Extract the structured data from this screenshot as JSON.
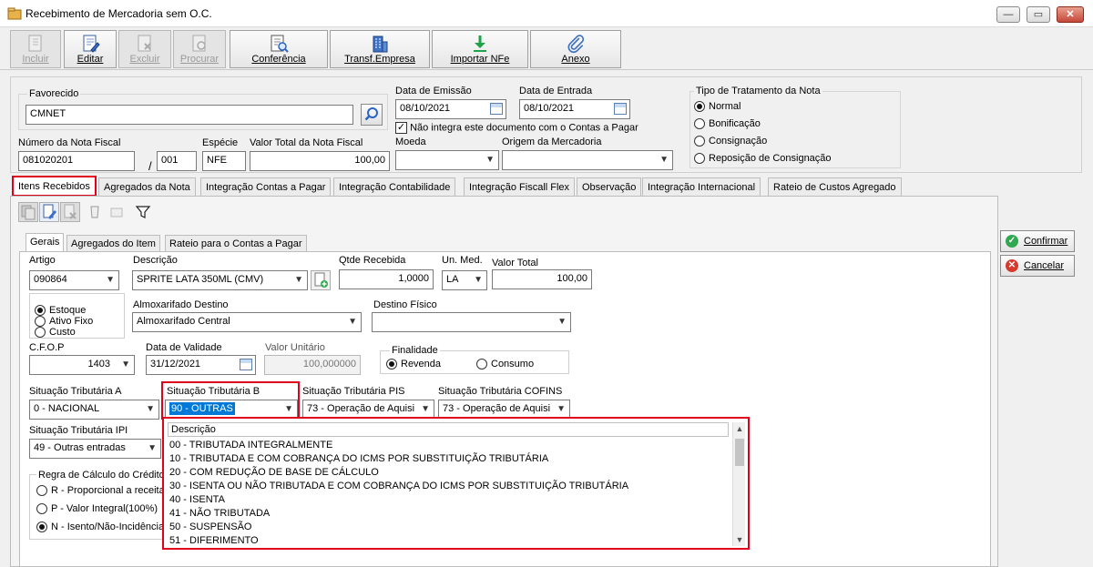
{
  "window": {
    "title": "Recebimento de Mercadoria sem O.C."
  },
  "toolbar": {
    "buttons": [
      {
        "label": "Incluir",
        "icon": "new-document-icon",
        "enabled": false
      },
      {
        "label": "Editar",
        "icon": "edit-document-icon",
        "enabled": true
      },
      {
        "label": "Excluir",
        "icon": "delete-document-icon",
        "enabled": false
      },
      {
        "label": "Procurar",
        "icon": "search-document-icon",
        "enabled": false
      },
      {
        "label": "Conferência",
        "icon": "conference-icon",
        "enabled": true
      },
      {
        "label": "Transf.Empresa",
        "icon": "building-icon",
        "enabled": true
      },
      {
        "label": "Importar NFe",
        "icon": "download-arrow-icon",
        "enabled": true
      },
      {
        "label": "Anexo",
        "icon": "paperclip-icon",
        "enabled": true
      }
    ]
  },
  "header": {
    "favorecido_label": "Favorecido",
    "favorecido_value": "CMNET",
    "data_emissao_label": "Data de Emissão",
    "data_emissao_value": "08/10/2021",
    "data_entrada_label": "Data de Entrada",
    "data_entrada_value": "08/10/2021",
    "nao_integra_label": "Não integra este documento com o Contas a Pagar",
    "nao_integra_checked": true,
    "tratamento_label": "Tipo de Tratamento da Nota",
    "tratamento_options": [
      "Normal",
      "Bonificação",
      "Consignação",
      "Reposição de Consignação"
    ],
    "tratamento_selected": "Normal",
    "numero_nf_label": "Número da Nota Fiscal",
    "numero_nf_value": "081020201",
    "serie_sep": "/",
    "serie_value": "001",
    "especie_label": "Espécie",
    "especie_value": "NFE",
    "valor_total_label": "Valor Total da Nota Fiscal",
    "valor_total_value": "100,00",
    "moeda_label": "Moeda",
    "moeda_value": "",
    "origem_label": "Origem da Mercadoria",
    "origem_value": ""
  },
  "main_tabs": [
    "Itens Recebidos",
    "Agregados da Nota",
    "Integração Contas a Pagar",
    "Integração Contabilidade",
    "Integração Fiscall Flex",
    "Observação",
    "Integração Internacional",
    "Rateio de Custos Agregado"
  ],
  "inner_tabs": [
    "Gerais",
    "Agregados do Item",
    "Rateio para o Contas a Pagar"
  ],
  "item": {
    "artigo_label": "Artigo",
    "artigo_value": "090864",
    "descricao_label": "Descrição",
    "descricao_value": "SPRITE LATA 350ML (CMV)",
    "qtde_label": "Qtde Recebida",
    "qtde_value": "1,0000",
    "unmed_label": "Un. Med.",
    "unmed_value": "LA",
    "valor_total_label": "Valor Total",
    "valor_total_value": "100,00",
    "tipo_options": [
      "Estoque",
      "Ativo Fixo",
      "Custo"
    ],
    "tipo_selected": "Estoque",
    "almox_label": "Almoxarifado Destino",
    "almox_value": "Almoxarifado Central",
    "destino_label": "Destino Físico",
    "destino_value": "",
    "cfop_label": "C.F.O.P",
    "cfop_value": "1403",
    "validade_label": "Data de Validade",
    "validade_value": "31/12/2021",
    "valor_unit_label": "Valor Unitário",
    "valor_unit_value": "100,000000",
    "finalidade_label": "Finalidade",
    "finalidade_options": [
      "Revenda",
      "Consumo"
    ],
    "finalidade_selected": "Revenda",
    "sit_a_label": "Situação Tributária A",
    "sit_a_value": "0  -  NACIONAL",
    "sit_b_label": "Situação Tributária B",
    "sit_b_value": "90  -  OUTRAS",
    "sit_pis_label": "Situação Tributária PIS",
    "sit_pis_value": "73 - Operação de Aquisi",
    "sit_cofins_label": "Situação Tributária COFINS",
    "sit_cofins_value": "73 - Operação de Aquisi",
    "sit_ipi_label": "Situação Tributária IPI",
    "sit_ipi_value": "49 - Outras entradas",
    "regra_label": "Regra de Cálculo do Crédito",
    "regra_options": [
      "R - Proporcional a receita",
      "P - Valor Integral(100%)",
      "N - Isento/Não-Incidência"
    ],
    "regra_selected": "N - Isento/Não-Incidência"
  },
  "dropdown_list": {
    "header": "Descrição",
    "rows": [
      "00  -  TRIBUTADA INTEGRALMENTE",
      "10  -  TRIBUTADA E COM COBRANÇA DO ICMS POR SUBSTITUIÇÃO TRIBUTÁRIA",
      "20  -  COM REDUÇÃO DE BASE DE CÁLCULO",
      "30  -  ISENTA OU NÃO TRIBUTADA E COM COBRANÇA DO ICMS POR SUBSTITUIÇÃO TRIBUTÁRIA",
      "40  -  ISENTA",
      "41  -  NÃO TRIBUTADA",
      "50  -  SUSPENSÃO",
      "51  -  DIFERIMENTO"
    ]
  },
  "side_buttons": {
    "confirm_label": "Confirmar",
    "cancel_label": "Cancelar"
  },
  "colors": {
    "highlight": "#e0001b",
    "selection": "#0078d7"
  }
}
